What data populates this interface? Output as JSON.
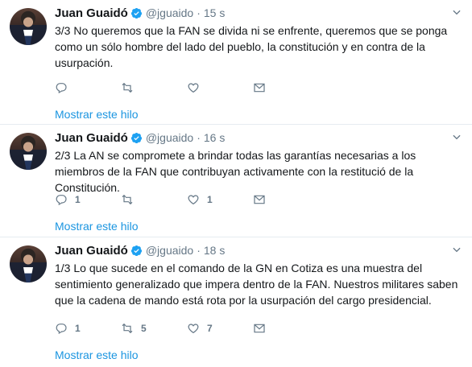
{
  "tweets": [
    {
      "name": "Juan Guaidó",
      "handle": "@jguaido",
      "separator": "·",
      "time": "15 s",
      "text": "3/3 No queremos que la FAN se divida ni se enfrente, queremos que se ponga como un sólo hombre del lado del pueblo, la constitución y en contra de la usurpación.",
      "reply_count": "",
      "retweet_count": "",
      "like_count": "",
      "thread_link": "Mostrar este hilo"
    },
    {
      "name": "Juan Guaidó",
      "handle": "@jguaido",
      "separator": "·",
      "time": "16 s",
      "text": "2/3 La AN se compromete a brindar todas las garantías necesarias a los miembros de la FAN que contribuyan activamente con la restitució de la Constitución.",
      "reply_count": "1",
      "retweet_count": "",
      "like_count": "1",
      "thread_link": "Mostrar este hilo"
    },
    {
      "name": "Juan Guaidó",
      "handle": "@jguaido",
      "separator": "·",
      "time": "18 s",
      "text": "1/3 Lo que sucede en el comando de la GN en Cotiza es una muestra del sentimiento generalizado que impera dentro de la FAN. Nuestros militares saben que la cadena de mando está rota por la usurpación del cargo presidencial.",
      "reply_count": "1",
      "retweet_count": "5",
      "like_count": "7",
      "thread_link": "Mostrar este hilo"
    }
  ],
  "icons": {
    "verified": "verified-badge-icon",
    "caret": "chevron-down-icon",
    "reply": "reply-icon",
    "retweet": "retweet-icon",
    "like": "heart-icon",
    "dm": "envelope-icon"
  },
  "colors": {
    "accent": "#1b95e0",
    "muted": "#657786",
    "text": "#14171a",
    "divider": "#e6ecf0"
  }
}
